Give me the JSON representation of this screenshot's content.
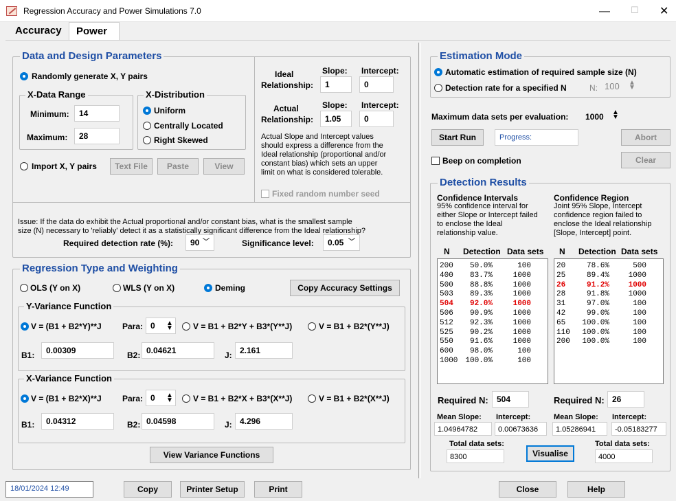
{
  "window": {
    "title": "Regression Accuracy and Power Simulations 7.0"
  },
  "tabs": [
    "Accuracy",
    "Power"
  ],
  "design": {
    "legend": "Data and Design Parameters",
    "random_label": "Randomly generate X, Y pairs",
    "xrange_label": "X-Data Range",
    "min_label": "Minimum:",
    "min_value": "14",
    "max_label": "Maximum:",
    "max_value": "28",
    "xdist_label": "X-Distribution",
    "dist_uniform": "Uniform",
    "dist_central": "Centrally Located",
    "dist_right": "Right Skewed",
    "import_label": "Import X, Y pairs",
    "text_file": "Text File",
    "paste": "Paste",
    "view": "View",
    "ideal_label_1": "Ideal",
    "ideal_label_2": "Relationship:",
    "actual_label_1": "Actual",
    "actual_label_2": "Relationship:",
    "slope_hdr": "Slope:",
    "intercept_hdr": "Intercept:",
    "ideal_slope": "1",
    "ideal_intercept": "0",
    "actual_slope": "1.05",
    "actual_intercept": "0",
    "note": [
      "Actual Slope and Intercept values",
      "should express a difference from the",
      "Ideal relationship (proportional and/or",
      "constant bias) which sets an upper",
      "limit on what is considered tolerable."
    ],
    "fixed_seed": "Fixed random number seed",
    "issue_1": "Issue:  If the data do exhibit the Actual proportional and/or constant bias, what is the smallest sample",
    "issue_2": "size (N) necessary to 'reliably' detect it as a statistically significant difference from the Ideal relationship?",
    "req_rate_label": "Required detection rate (%):",
    "req_rate_value": "90",
    "sig_label": "Significance level:",
    "sig_value": "0.05"
  },
  "regression": {
    "legend": "Regression Type and Weighting",
    "ols": "OLS (Y on X)",
    "wls": "WLS (Y on X)",
    "deming": "Deming",
    "copy_btn": "Copy Accuracy Settings",
    "yvar_legend": "Y-Variance Function",
    "xvar_legend": "X-Variance Function",
    "y_opt1": "V = (B1 + B2*Y)**J",
    "y_opt2": "V = B1 + B2*Y + B3*(Y**J)",
    "y_opt3": "V = B1 + B2*(Y**J)",
    "x_opt1": "V = (B1 + B2*X)**J",
    "x_opt2": "V = B1 + B2*X + B3*(X**J)",
    "x_opt3": "V = B1 + B2*(X**J)",
    "para_label": "Para:",
    "y_para": "0",
    "x_para": "0",
    "b1_label": "B1:",
    "b2_label": "B2:",
    "j_label": "J:",
    "y_b1": "0.00309",
    "y_b2": "0.04621",
    "y_j": "2.161",
    "x_b1": "0.04312",
    "x_b2": "0.04598",
    "x_j": "4.296",
    "view_btn": "View Variance Functions"
  },
  "estimation": {
    "legend": "Estimation Mode",
    "auto": "Automatic estimation of required sample size (N)",
    "detect": "Detection rate for a specified N",
    "n_label": "N:",
    "n_value": "100",
    "max_label": "Maximum data sets per evaluation:",
    "max_value": "1000",
    "start": "Start Run",
    "progress": "Progress:",
    "abort": "Abort",
    "beep": "Beep on completion",
    "clear": "Clear"
  },
  "results": {
    "legend": "Detection Results",
    "ci_title": "Confidence Intervals",
    "ci_desc": [
      "95% confidence interval for",
      "either Slope or Intercept failed",
      "to enclose the Ideal",
      "relationship value."
    ],
    "cr_title": "Confidence Region",
    "cr_desc": [
      "Joint 95% Slope, Intercept",
      "confidence region failed to",
      "enclose the Ideal relationship",
      "[Slope, Intercept] point."
    ],
    "col_n": "N",
    "col_det": "Detection",
    "col_sets": "Data sets",
    "ci_rows": [
      [
        "200",
        "50.0%",
        "100"
      ],
      [
        "400",
        "83.7%",
        "1000"
      ],
      [
        "500",
        "88.8%",
        "1000"
      ],
      [
        "503",
        "89.3%",
        "1000"
      ],
      [
        "504",
        "92.0%",
        "1000"
      ],
      [
        "506",
        "90.9%",
        "1000"
      ],
      [
        "512",
        "92.3%",
        "1000"
      ],
      [
        "525",
        "90.2%",
        "1000"
      ],
      [
        "550",
        "91.6%",
        "1000"
      ],
      [
        "600",
        "98.0%",
        "100"
      ],
      [
        "1000",
        "100.0%",
        "100"
      ]
    ],
    "ci_highlight": 4,
    "cr_rows": [
      [
        "20",
        "78.6%",
        "500"
      ],
      [
        "25",
        "89.4%",
        "1000"
      ],
      [
        "26",
        "91.2%",
        "1000"
      ],
      [
        "28",
        "91.8%",
        "1000"
      ],
      [
        "31",
        "97.0%",
        "100"
      ],
      [
        "42",
        "99.0%",
        "100"
      ],
      [
        "65",
        "100.0%",
        "100"
      ],
      [
        "110",
        "100.0%",
        "100"
      ],
      [
        "200",
        "100.0%",
        "100"
      ]
    ],
    "cr_highlight": 2,
    "req_n_label": "Required N:",
    "ci_req_n": "504",
    "cr_req_n": "26",
    "mean_slope_label": "Mean Slope:",
    "intercept_label": "Intercept:",
    "ci_mean_slope": "1.04964782",
    "ci_intercept": "0.00673636",
    "cr_mean_slope": "1.05286941",
    "cr_intercept": "-0.05183277",
    "total_label": "Total data sets:",
    "ci_total": "8300",
    "cr_total": "4000",
    "visualise": "Visualise"
  },
  "footer": {
    "datetime": "18/01/2024  12:49",
    "copy": "Copy",
    "printer_setup": "Printer Setup",
    "print": "Print",
    "close": "Close",
    "help": "Help"
  }
}
